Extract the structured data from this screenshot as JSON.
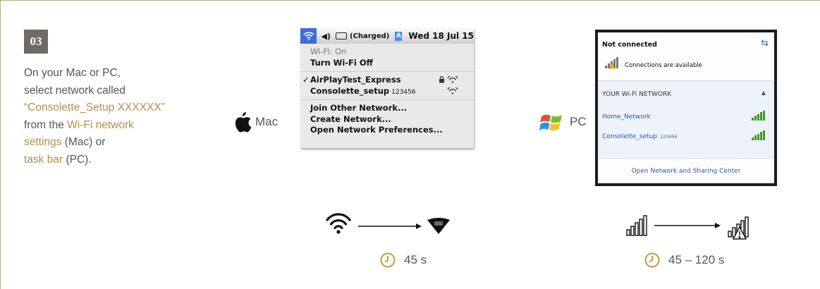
{
  "step": {
    "number": "03"
  },
  "instructions": {
    "line1": "On your Mac or PC,",
    "line2": "select network called",
    "network_name": "“Consolette_Setup XXXXXX”",
    "line4_prefix": "from the ",
    "wifi_link_a": "Wi-Fi network",
    "wifi_link_b": "settings",
    "mac_suffix": " (Mac) or",
    "taskbar_link": "task bar",
    "pc_suffix": " (PC)."
  },
  "mac": {
    "label": "Mac",
    "status_bar": {
      "battery_text": "(Charged)",
      "input_badge": "A",
      "datetime": "Wed 18 Jul 15"
    },
    "menu": {
      "wifi_status": "Wi-Fi: On",
      "turn_off": "Turn Wi-Fi Off",
      "network_1": "AirPlayTest_Express",
      "network_2": "Consolette_setup",
      "network_2_suffix": "123456",
      "join_other": "Join Other Network...",
      "create": "Create Network...",
      "preferences": "Open Network Preferences..."
    }
  },
  "pc": {
    "label": "PC",
    "popup": {
      "status": "Not connected",
      "connections": "Connections are available",
      "section_header": "YOUR Wi-Fi NETWORK",
      "network_1": "Home_Network",
      "network_2": "Consolette_setup",
      "network_2_suffix": "123456",
      "open_center": "Open Network and Sharing Center"
    }
  },
  "timing": {
    "mac": "45 s",
    "pc": "45 – 120 s"
  },
  "icons": {
    "mac_os": "apple-logo-icon",
    "pc_os": "windows-logo-icon",
    "timer": "clock-icon"
  },
  "colors": {
    "accent": "#b48f4e",
    "timer_accent": "#c9a24a",
    "win_link": "#1f56b3",
    "mac_highlight": "#3a6ed8"
  }
}
